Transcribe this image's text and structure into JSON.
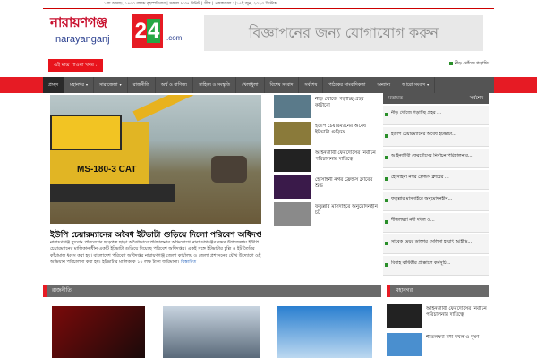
{
  "topbar": {
    "date_text": "১লা আষাঢ়, ১৪৩০ বঙ্গাব্দ বৃহস্পতিবার | সকাল ৯:৩৪ মিনিট | গ্রীষ্ম | প্রকাশকাল : |১৫ই জুন, ২০২৩ খ্রিস্টাব্দ"
  },
  "logo": {
    "name": "নারায়ণগঞ্জ",
    "sub": "narayanganj",
    "num_a": "2",
    "num_b": "4",
    "com": ".com"
  },
  "ad": {
    "text": "বিজ্ঞাপনের জন্য যোগাযোগ করুন"
  },
  "ticker": {
    "label": "এই মাত্র পাওয়া খবর :",
    "item": "নীড় খোঁজে গড়াচ্চি"
  },
  "nav": {
    "items": [
      {
        "label": "প্রচ্ছদ",
        "caret": ""
      },
      {
        "label": "মহানগর",
        "caret": "▾"
      },
      {
        "label": "সারাজেলা",
        "caret": "▾"
      },
      {
        "label": "রাজনীতি",
        "caret": ""
      },
      {
        "label": "অর্থ ও বাণিজ্য",
        "caret": ""
      },
      {
        "label": "সাহিত্য ও সংস্কৃতি",
        "caret": ""
      },
      {
        "label": "খেলাধুলা",
        "caret": ""
      },
      {
        "label": "বিশেষ সংবাদ",
        "caret": ""
      },
      {
        "label": "সর্বশেষ",
        "caret": ""
      },
      {
        "label": "পাঠকের সাংবাদিকতা",
        "caret": ""
      },
      {
        "label": "অন্যান্য",
        "caret": ""
      },
      {
        "label": "আরো সংবাদ",
        "caret": "▾"
      }
    ]
  },
  "hero": {
    "machine_mark": "MS-180-3 CAT",
    "title": "ইউপি চেয়ারম্যানের অবৈধ ইটভাটা গুড়িয়ে দিলো পরিবেশ অধিদপ্তর",
    "body": "নারায়ণগঞ্জ ব্যুরোঃ পরিবেশের ছাড়পত্র ছাড়া অবৈধভাবে পরিচালনার অভিযোগে নারায়ণগঞ্জের বন্দর উপজেলায় ইউপি চেয়ারম্যানের মালিকানাধীন একটি ইটভাটা গুড়িয়ে দিয়েছে পরিবেশ অধিদপ্তর। একই সঙ্গে ইটভাটার চুল্লি ও ইট তৈরির কাঁচামাল ধ্বংস করা হয়। বাংলাদেশ পরিবেশ অধিদপ্তর নারায়ণগঞ্জ জেলা কার্যালয় ও জেলা প্রশাসনের যৌথ উদ্যোগে ওই অভিযান পরিচালনা করা হয়। ইটভাটার মালিককে ১০ লক্ষ টাকা জরিমানা।",
    "more": "বিস্তারিত"
  },
  "mid_list": [
    {
      "text": "নীড় খোঁজে গড়াচ্ছি প্রহর কাটাবো",
      "thumb": "#5a7a8a"
    },
    {
      "text": "ইউপি চেয়ারম্যানের অবৈধ ইটভাটা গুড়িয়ে",
      "thumb": "#8a7a3a"
    },
    {
      "text": "আইনজীবী ফেরদৌসের নির্বাচন পরিচালনার দায়িত্বে",
      "thumb": "#222222"
    },
    {
      "text": "হোসাইনী নগর ফ্রেন্ডস ক্লাবের শুভ",
      "thumb": "#3a1a4a"
    },
    {
      "text": "ফতুল্লার মাসদাইরে অনুমোদনহীন চট",
      "thumb": "#8a8a8a"
    }
  ],
  "right_col": {
    "tab_a": "মতামত",
    "tab_b": "সর্বশেষ",
    "items": [
      "নীড় খোঁজে গড়াচ্ছি প্রহর ...",
      "ইউপি চেয়ারম্যানের অবৈধ ইটভাটা...",
      "আইনজীবী ফেরদৌসের নির্বাচন পরিচালনার...",
      "হোসাইনী নগর ফ্রেন্ডস ক্লাবের ...",
      "ফতুল্লার মাসদাইরে অনুমোদনহীন...",
      "শীতলক্ষ্যা নদী দখল ও...",
      "সাবেক মেয়র ডাক্তার সেলিনা হায়াৎ আইভি...",
      "বিবাহ বার্ষিকীর প্রাক্কালে কর্মসূচি..."
    ]
  },
  "sections": {
    "left": "রাজনীতি",
    "right": "মহানগর"
  },
  "bottom_right": [
    {
      "text": "আইনজীবী ফেরদৌসের নির্বাচন পরিচালনার দায়িত্বে",
      "thumb": "#222222"
    },
    {
      "text": "শীতলক্ষ্যা নদী দখল ও দূষণ",
      "thumb": "#4a8fcf"
    }
  ]
}
